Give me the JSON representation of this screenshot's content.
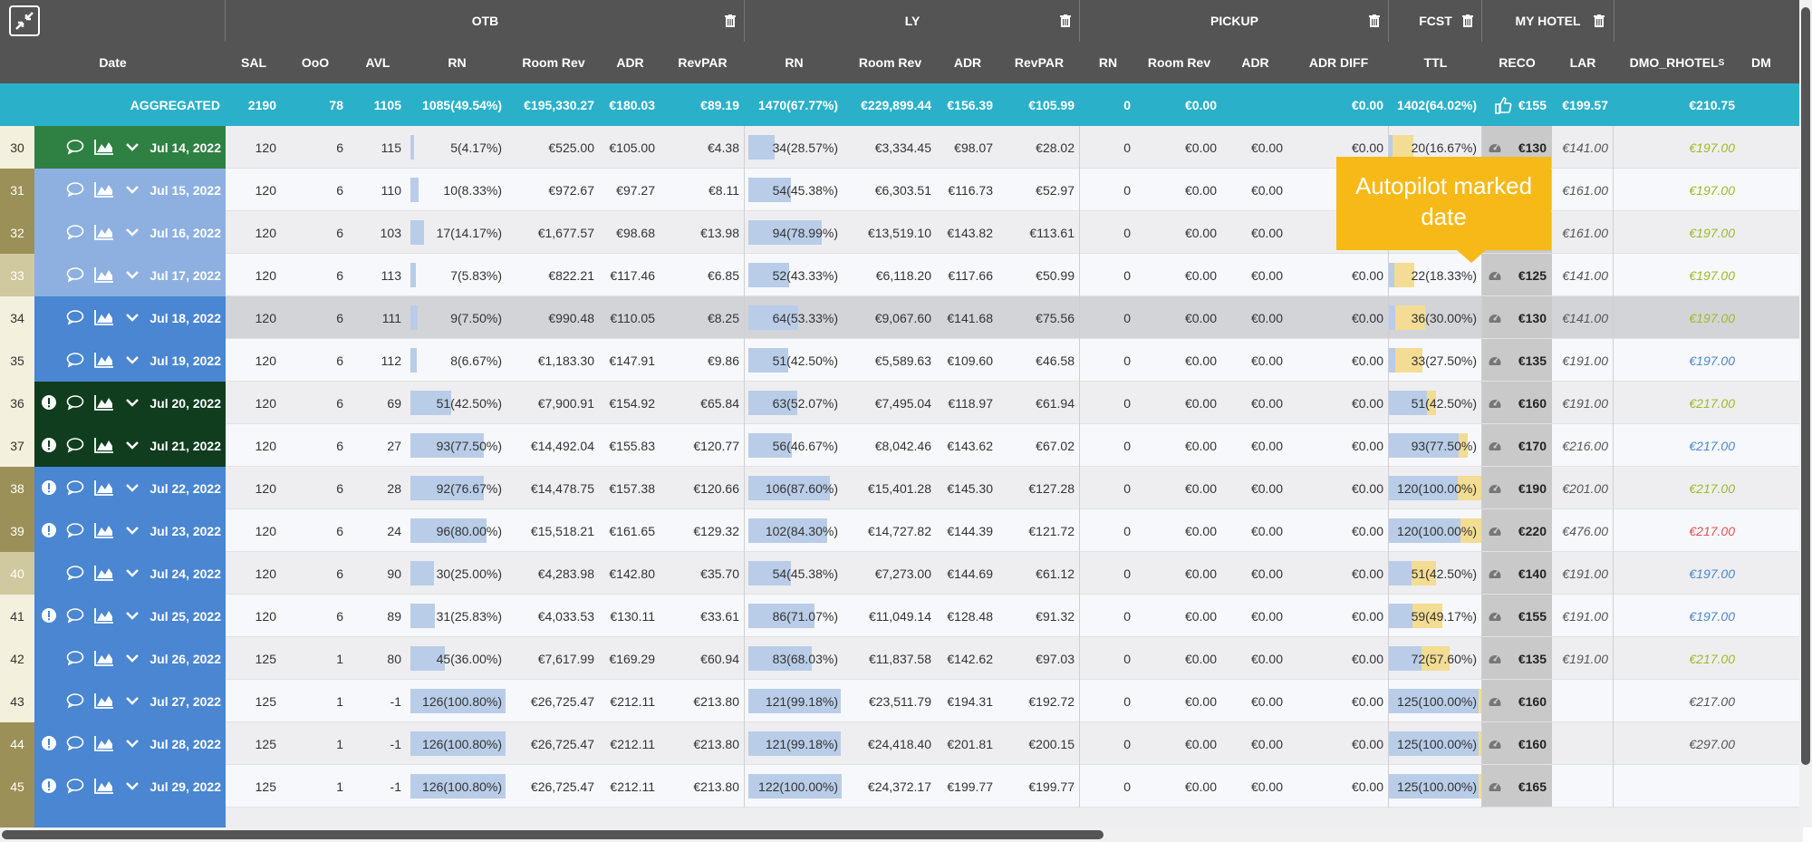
{
  "groups": {
    "otb": "OTB",
    "ly": "LY",
    "pickup": "PICKUP",
    "fcst": "FCST",
    "my_hotel": "MY HOTEL"
  },
  "headers": {
    "date": "Date",
    "sal": "SAL",
    "ooo": "OoO",
    "avl": "AVL",
    "rn": "RN",
    "room_rev": "Room Rev",
    "adr": "ADR",
    "revpar": "RevPAR",
    "ly_rn": "RN",
    "ly_room_rev": "Room Rev",
    "ly_adr": "ADR",
    "ly_revpar": "RevPAR",
    "pu_rn": "RN",
    "pu_room_rev": "Room Rev",
    "pu_adr": "ADR",
    "pu_adr_diff": "ADR DIFF",
    "fc_ttl": "TTL",
    "reco": "RECO",
    "lar": "LAR",
    "dmo": "DMO_RHOTEL",
    "dmo_sup": "S",
    "dm": "DM"
  },
  "aggregated": {
    "label": "AGGREGATED",
    "sal": "2190",
    "ooo": "78",
    "avl": "1105",
    "rn": "1085(49.54%)",
    "room_rev": "€195,330.27",
    "adr": "€180.03",
    "revpar": "€89.19",
    "ly_rn": "1470(67.77%)",
    "ly_room_rev": "€229,899.44",
    "ly_adr": "€156.39",
    "ly_revpar": "€105.99",
    "pu_rn": "0",
    "pu_room_rev": "€0.00",
    "pu_adr": "",
    "pu_adr_diff": "€0.00",
    "fc_ttl": "1402(64.02%)",
    "reco": "€155",
    "lar": "€199.57",
    "dmo": "€210.75"
  },
  "tooltip": "Autopilot marked date",
  "colors": {
    "header": "#545454",
    "aggregated": "#2bb0c9",
    "tooltip": "#f7b917",
    "bar": "#b9cde8",
    "fcst_bar": "#f3dc93",
    "reco_col": "#c9c9c9"
  },
  "rows": [
    {
      "num": "30",
      "warn": false,
      "date": "Jul 14, 2022",
      "dcol": "#2e8142",
      "ncol": "#f3f0dd",
      "sal": "120",
      "ooo": "6",
      "avl": "115",
      "rn": "5(4.17%)",
      "rn_pct": 4.17,
      "room_rev": "€525.00",
      "adr": "€105.00",
      "revpar": "€4.38",
      "ly_rn": "34(28.57%)",
      "ly_pct": 28.57,
      "ly_room_rev": "€3,334.45",
      "ly_adr": "€98.07",
      "ly_revpar": "€28.02",
      "pu_rn": "0",
      "pu_room_rev": "€0.00",
      "pu_adr": "€0.00",
      "pu_adr_diff": "€0.00",
      "fc_ttl": "20(16.67%)",
      "fc_pct": 16.67,
      "fc_otb": 4.17,
      "reco": "€130",
      "lar": "€141.00",
      "dmo": "€197.00",
      "dmo_col": "#9cb929",
      "bg": "#eeeef0"
    },
    {
      "num": "31",
      "warn": false,
      "date": "Jul 15, 2022",
      "dcol": "#8db0e0",
      "ncol": "#9b9057",
      "sal": "120",
      "ooo": "6",
      "avl": "110",
      "rn": "10(8.33%)",
      "rn_pct": 8.33,
      "room_rev": "€972.67",
      "adr": "€97.27",
      "revpar": "€8.11",
      "ly_rn": "54(45.38%)",
      "ly_pct": 45.38,
      "ly_room_rev": "€6,303.51",
      "ly_adr": "€116.73",
      "ly_revpar": "€52.97",
      "pu_rn": "0",
      "pu_room_rev": "€0.00",
      "pu_adr": "€0.00",
      "pu_adr_diff": "",
      "fc_ttl": "",
      "fc_pct": 0,
      "fc_otb": 0,
      "reco": "",
      "lar": "€161.00",
      "dmo": "€197.00",
      "dmo_col": "#9cb929",
      "bg": "#f7f8fb"
    },
    {
      "num": "32",
      "warn": false,
      "date": "Jul 16, 2022",
      "dcol": "#8db0e0",
      "ncol": "#9b9057",
      "sal": "120",
      "ooo": "6",
      "avl": "103",
      "rn": "17(14.17%)",
      "rn_pct": 14.17,
      "room_rev": "€1,677.57",
      "adr": "€98.68",
      "revpar": "€13.98",
      "ly_rn": "94(78.99%)",
      "ly_pct": 78.99,
      "ly_room_rev": "€13,519.10",
      "ly_adr": "€143.82",
      "ly_revpar": "€113.61",
      "pu_rn": "0",
      "pu_room_rev": "€0.00",
      "pu_adr": "€0.00",
      "pu_adr_diff": "",
      "fc_ttl": "",
      "fc_pct": 0,
      "fc_otb": 0,
      "reco": "",
      "lar": "€161.00",
      "dmo": "€197.00",
      "dmo_col": "#9cb929",
      "bg": "#eeeef0"
    },
    {
      "num": "33",
      "warn": false,
      "date": "Jul 17, 2022",
      "dcol": "#8db0e0",
      "ncol": "#d0c89e",
      "sal": "120",
      "ooo": "6",
      "avl": "113",
      "rn": "7(5.83%)",
      "rn_pct": 5.83,
      "room_rev": "€822.21",
      "adr": "€117.46",
      "revpar": "€6.85",
      "ly_rn": "52(43.33%)",
      "ly_pct": 43.33,
      "ly_room_rev": "€6,118.20",
      "ly_adr": "€117.66",
      "ly_revpar": "€50.99",
      "pu_rn": "0",
      "pu_room_rev": "€0.00",
      "pu_adr": "€0.00",
      "pu_adr_diff": "€0.00",
      "fc_ttl": "22(18.33%)",
      "fc_pct": 18.33,
      "fc_otb": 5.83,
      "reco": "€125",
      "lar": "€141.00",
      "dmo": "€197.00",
      "dmo_col": "#9cb929",
      "bg": "#f7f8fb"
    },
    {
      "num": "34",
      "warn": false,
      "date": "Jul 18, 2022",
      "dcol": "#4a86d1",
      "ncol": "#f3f0dd",
      "sal": "120",
      "ooo": "6",
      "avl": "111",
      "rn": "9(7.50%)",
      "rn_pct": 7.5,
      "room_rev": "€990.48",
      "adr": "€110.05",
      "revpar": "€8.25",
      "ly_rn": "64(53.33%)",
      "ly_pct": 53.33,
      "ly_room_rev": "€9,067.60",
      "ly_adr": "€141.68",
      "ly_revpar": "€75.56",
      "pu_rn": "0",
      "pu_room_rev": "€0.00",
      "pu_adr": "€0.00",
      "pu_adr_diff": "€0.00",
      "fc_ttl": "36(30.00%)",
      "fc_pct": 30,
      "fc_otb": 7.5,
      "reco": "€130",
      "lar": "€141.00",
      "dmo": "€197.00",
      "dmo_col": "#9cb929",
      "bg": "#d3d4d8"
    },
    {
      "num": "35",
      "warn": false,
      "date": "Jul 19, 2022",
      "dcol": "#4a86d1",
      "ncol": "#f3f0dd",
      "sal": "120",
      "ooo": "6",
      "avl": "112",
      "rn": "8(6.67%)",
      "rn_pct": 6.67,
      "room_rev": "€1,183.30",
      "adr": "€147.91",
      "revpar": "€9.86",
      "ly_rn": "51(42.50%)",
      "ly_pct": 42.5,
      "ly_room_rev": "€5,589.63",
      "ly_adr": "€109.60",
      "ly_revpar": "€46.58",
      "pu_rn": "0",
      "pu_room_rev": "€0.00",
      "pu_adr": "€0.00",
      "pu_adr_diff": "€0.00",
      "fc_ttl": "33(27.50%)",
      "fc_pct": 27.5,
      "fc_otb": 6.67,
      "reco": "€135",
      "lar": "€191.00",
      "dmo": "€197.00",
      "dmo_col": "#4a86d1",
      "bg": "#f7f8fb"
    },
    {
      "num": "36",
      "warn": true,
      "date": "Jul 20, 2022",
      "dcol": "#0f3d1e",
      "ncol": "#f3f0dd",
      "sal": "120",
      "ooo": "6",
      "avl": "69",
      "rn": "51(42.50%)",
      "rn_pct": 42.5,
      "room_rev": "€7,900.91",
      "adr": "€154.92",
      "revpar": "€65.84",
      "ly_rn": "63(52.07%)",
      "ly_pct": 52.07,
      "ly_room_rev": "€7,495.04",
      "ly_adr": "€118.97",
      "ly_revpar": "€61.94",
      "pu_rn": "0",
      "pu_room_rev": "€0.00",
      "pu_adr": "€0.00",
      "pu_adr_diff": "€0.00",
      "fc_ttl": "51(42.50%)",
      "fc_pct": 42.5,
      "fc_otb": 42.5,
      "reco": "€160",
      "lar": "€191.00",
      "dmo": "€217.00",
      "dmo_col": "#9cb929",
      "bg": "#eeeef0"
    },
    {
      "num": "37",
      "warn": true,
      "date": "Jul 21, 2022",
      "dcol": "#0f3d1e",
      "ncol": "#f3f0dd",
      "sal": "120",
      "ooo": "6",
      "avl": "27",
      "rn": "93(77.50%)",
      "rn_pct": 77.5,
      "room_rev": "€14,492.04",
      "adr": "€155.83",
      "revpar": "€120.77",
      "ly_rn": "56(46.67%)",
      "ly_pct": 46.67,
      "ly_room_rev": "€8,042.46",
      "ly_adr": "€143.62",
      "ly_revpar": "€67.02",
      "pu_rn": "0",
      "pu_room_rev": "€0.00",
      "pu_adr": "€0.00",
      "pu_adr_diff": "€0.00",
      "fc_ttl": "93(77.50%)",
      "fc_pct": 77.5,
      "fc_otb": 77.5,
      "reco": "€170",
      "lar": "€216.00",
      "dmo": "€217.00",
      "dmo_col": "#4a86d1",
      "bg": "#f7f8fb"
    },
    {
      "num": "38",
      "warn": true,
      "date": "Jul 22, 2022",
      "dcol": "#4a86d1",
      "ncol": "#9b9057",
      "sal": "120",
      "ooo": "6",
      "avl": "28",
      "rn": "92(76.67%)",
      "rn_pct": 76.67,
      "room_rev": "€14,478.75",
      "adr": "€157.38",
      "revpar": "€120.66",
      "ly_rn": "106(87.60%)",
      "ly_pct": 87.6,
      "ly_room_rev": "€15,401.28",
      "ly_adr": "€145.30",
      "ly_revpar": "€127.28",
      "pu_rn": "0",
      "pu_room_rev": "€0.00",
      "pu_adr": "€0.00",
      "pu_adr_diff": "€0.00",
      "fc_ttl": "120(100.00%)",
      "fc_pct": 100,
      "fc_otb": 76.67,
      "reco": "€190",
      "lar": "€201.00",
      "dmo": "€217.00",
      "dmo_col": "#9cb929",
      "bg": "#eeeef0"
    },
    {
      "num": "39",
      "warn": true,
      "date": "Jul 23, 2022",
      "dcol": "#4a86d1",
      "ncol": "#9b9057",
      "sal": "120",
      "ooo": "6",
      "avl": "24",
      "rn": "96(80.00%)",
      "rn_pct": 80,
      "room_rev": "€15,518.21",
      "adr": "€161.65",
      "revpar": "€129.32",
      "ly_rn": "102(84.30%)",
      "ly_pct": 84.3,
      "ly_room_rev": "€14,727.82",
      "ly_adr": "€144.39",
      "ly_revpar": "€121.72",
      "pu_rn": "0",
      "pu_room_rev": "€0.00",
      "pu_adr": "€0.00",
      "pu_adr_diff": "€0.00",
      "fc_ttl": "120(100.00%)",
      "fc_pct": 100,
      "fc_otb": 80,
      "reco": "€220",
      "lar": "€476.00",
      "dmo": "€217.00",
      "dmo_col": "#e05252",
      "bg": "#f7f8fb"
    },
    {
      "num": "40",
      "warn": false,
      "date": "Jul 24, 2022",
      "dcol": "#4a86d1",
      "ncol": "#d0c89e",
      "sal": "120",
      "ooo": "6",
      "avl": "90",
      "rn": "30(25.00%)",
      "rn_pct": 25,
      "room_rev": "€4,283.98",
      "adr": "€142.80",
      "revpar": "€35.70",
      "ly_rn": "54(45.38%)",
      "ly_pct": 45.38,
      "ly_room_rev": "€7,273.00",
      "ly_adr": "€144.69",
      "ly_revpar": "€61.12",
      "pu_rn": "0",
      "pu_room_rev": "€0.00",
      "pu_adr": "€0.00",
      "pu_adr_diff": "€0.00",
      "fc_ttl": "51(42.50%)",
      "fc_pct": 42.5,
      "fc_otb": 25,
      "reco": "€140",
      "lar": "€191.00",
      "dmo": "€197.00",
      "dmo_col": "#4a86d1",
      "bg": "#eeeef0"
    },
    {
      "num": "41",
      "warn": true,
      "date": "Jul 25, 2022",
      "dcol": "#4a86d1",
      "ncol": "#f3f0dd",
      "sal": "120",
      "ooo": "6",
      "avl": "89",
      "rn": "31(25.83%)",
      "rn_pct": 25.83,
      "room_rev": "€4,033.53",
      "adr": "€130.11",
      "revpar": "€33.61",
      "ly_rn": "86(71.07%)",
      "ly_pct": 71.07,
      "ly_room_rev": "€11,049.14",
      "ly_adr": "€128.48",
      "ly_revpar": "€91.32",
      "pu_rn": "0",
      "pu_room_rev": "€0.00",
      "pu_adr": "€0.00",
      "pu_adr_diff": "€0.00",
      "fc_ttl": "59(49.17%)",
      "fc_pct": 49.17,
      "fc_otb": 25.83,
      "reco": "€155",
      "lar": "€191.00",
      "dmo": "€197.00",
      "dmo_col": "#4a86d1",
      "bg": "#f7f8fb"
    },
    {
      "num": "42",
      "warn": false,
      "date": "Jul 26, 2022",
      "dcol": "#4a86d1",
      "ncol": "#f3f0dd",
      "sal": "125",
      "ooo": "1",
      "avl": "80",
      "rn": "45(36.00%)",
      "rn_pct": 36,
      "room_rev": "€7,617.99",
      "adr": "€169.29",
      "revpar": "€60.94",
      "ly_rn": "83(68.03%)",
      "ly_pct": 68.03,
      "ly_room_rev": "€11,837.58",
      "ly_adr": "€142.62",
      "ly_revpar": "€97.03",
      "pu_rn": "0",
      "pu_room_rev": "€0.00",
      "pu_adr": "€0.00",
      "pu_adr_diff": "€0.00",
      "fc_ttl": "72(57.60%)",
      "fc_pct": 57.6,
      "fc_otb": 36,
      "reco": "€135",
      "lar": "€191.00",
      "dmo": "€217.00",
      "dmo_col": "#9cb929",
      "bg": "#eeeef0"
    },
    {
      "num": "43",
      "warn": false,
      "date": "Jul 27, 2022",
      "dcol": "#4a86d1",
      "ncol": "#f3f0dd",
      "sal": "125",
      "ooo": "1",
      "avl": "-1",
      "rn": "126(100.80%)",
      "rn_pct": 100,
      "room_rev": "€26,725.47",
      "adr": "€212.11",
      "revpar": "€213.80",
      "ly_rn": "121(99.18%)",
      "ly_pct": 99.18,
      "ly_room_rev": "€23,511.79",
      "ly_adr": "€194.31",
      "ly_revpar": "€192.72",
      "pu_rn": "0",
      "pu_room_rev": "€0.00",
      "pu_adr": "€0.00",
      "pu_adr_diff": "€0.00",
      "fc_ttl": "125(100.00%)",
      "fc_pct": 100,
      "fc_otb": 100,
      "reco": "€160",
      "lar": "",
      "dmo": "€217.00",
      "dmo_col": "#555555",
      "bg": "#f7f8fb"
    },
    {
      "num": "44",
      "warn": true,
      "date": "Jul 28, 2022",
      "dcol": "#4a86d1",
      "ncol": "#9b9057",
      "sal": "125",
      "ooo": "1",
      "avl": "-1",
      "rn": "126(100.80%)",
      "rn_pct": 100,
      "room_rev": "€26,725.47",
      "adr": "€212.11",
      "revpar": "€213.80",
      "ly_rn": "121(99.18%)",
      "ly_pct": 99.18,
      "ly_room_rev": "€24,418.40",
      "ly_adr": "€201.81",
      "ly_revpar": "€200.15",
      "pu_rn": "0",
      "pu_room_rev": "€0.00",
      "pu_adr": "€0.00",
      "pu_adr_diff": "€0.00",
      "fc_ttl": "125(100.00%)",
      "fc_pct": 100,
      "fc_otb": 100,
      "reco": "€160",
      "lar": "",
      "dmo": "€297.00",
      "dmo_col": "#555555",
      "bg": "#eeeef0"
    },
    {
      "num": "45",
      "warn": true,
      "date": "Jul 29, 2022",
      "dcol": "#4a86d1",
      "ncol": "#9b9057",
      "sal": "125",
      "ooo": "1",
      "avl": "-1",
      "rn": "126(100.80%)",
      "rn_pct": 100,
      "room_rev": "€26,725.47",
      "adr": "€212.11",
      "revpar": "€213.80",
      "ly_rn": "122(100.00%)",
      "ly_pct": 100,
      "ly_room_rev": "€24,372.17",
      "ly_adr": "€199.77",
      "ly_revpar": "€199.77",
      "pu_rn": "0",
      "pu_room_rev": "€0.00",
      "pu_adr": "€0.00",
      "pu_adr_diff": "€0.00",
      "fc_ttl": "125(100.00%)",
      "fc_pct": 100,
      "fc_otb": 100,
      "reco": "€165",
      "lar": "",
      "dmo": "",
      "dmo_col": "#555555",
      "bg": "#f7f8fb"
    }
  ]
}
